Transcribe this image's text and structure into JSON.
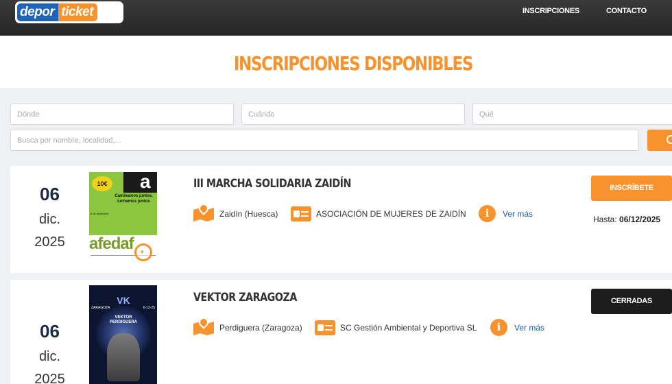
{
  "header": {
    "logo": {
      "part1": "depor",
      "part2": "ticket"
    },
    "nav": [
      "INSCRIPCIONES",
      "CONTACTO"
    ]
  },
  "page": {
    "title": "INSCRIPCIONES DISPONIBLES"
  },
  "filters": {
    "donde_placeholder": "Dónde",
    "cuando_placeholder": "Cuándo",
    "que_placeholder": "Qué",
    "busca_placeholder": "Busca por nombre, localidad,..."
  },
  "events": [
    {
      "day": "06",
      "month": "dic.",
      "year": "2025",
      "title": "III MARCHA SOLIDARIA ZAIDÍN",
      "location": "Zaidín (Huesca)",
      "organizer": "ASOCIACIÓN DE MUJERES DE ZAIDÍN",
      "more": "Ver más",
      "button": "INSCRÍBETE",
      "deadline_label": "Hasta:",
      "deadline": "06/12/2025",
      "poster": {
        "price": "10€",
        "letter": "a",
        "slogan": "Caminamos juntos, luchamos juntos",
        "org": "afedaf",
        "date_line": "6 de diciembre"
      }
    },
    {
      "day": "06",
      "month": "dic.",
      "year": "2025",
      "title": "VEKTOR ZARAGOZA",
      "location": "Perdiguera (Zaragoza)",
      "organizer": "SC Gestión Ambiental y Deportiva SL",
      "more": "Ver más",
      "button": "CERRADAS",
      "poster": {
        "city": "ZARAGOZA",
        "date": "6-12-25",
        "logo": "VK",
        "title_line1": "VEKTOR",
        "title_line2": "PERDIGUERA"
      }
    }
  ],
  "colors": {
    "accent": "#f7922c",
    "link": "#1d5aa8",
    "dark": "#1d1d1d",
    "brand_blue": "#1d64b8"
  }
}
